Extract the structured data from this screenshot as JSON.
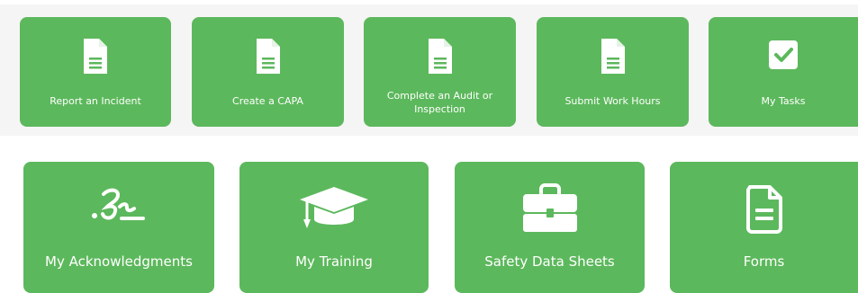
{
  "quick_actions": [
    {
      "label": "Report an Incident",
      "icon": "document-icon"
    },
    {
      "label": "Create a CAPA",
      "icon": "document-icon"
    },
    {
      "label": "Complete an Audit or Inspection",
      "icon": "document-icon"
    },
    {
      "label": "Submit Work Hours",
      "icon": "document-icon"
    },
    {
      "label": "My Tasks",
      "icon": "checkbox-icon"
    }
  ],
  "modules": [
    {
      "label": "My Acknowledgments",
      "icon": "signature-icon"
    },
    {
      "label": "My Training",
      "icon": "graduation-cap-icon"
    },
    {
      "label": "Safety Data Sheets",
      "icon": "briefcase-icon"
    },
    {
      "label": "Forms",
      "icon": "form-document-icon"
    }
  ],
  "colors": {
    "tile_green": "#5cb85c",
    "top_band": "#f5f5f5",
    "icon_white": "#ffffff"
  }
}
